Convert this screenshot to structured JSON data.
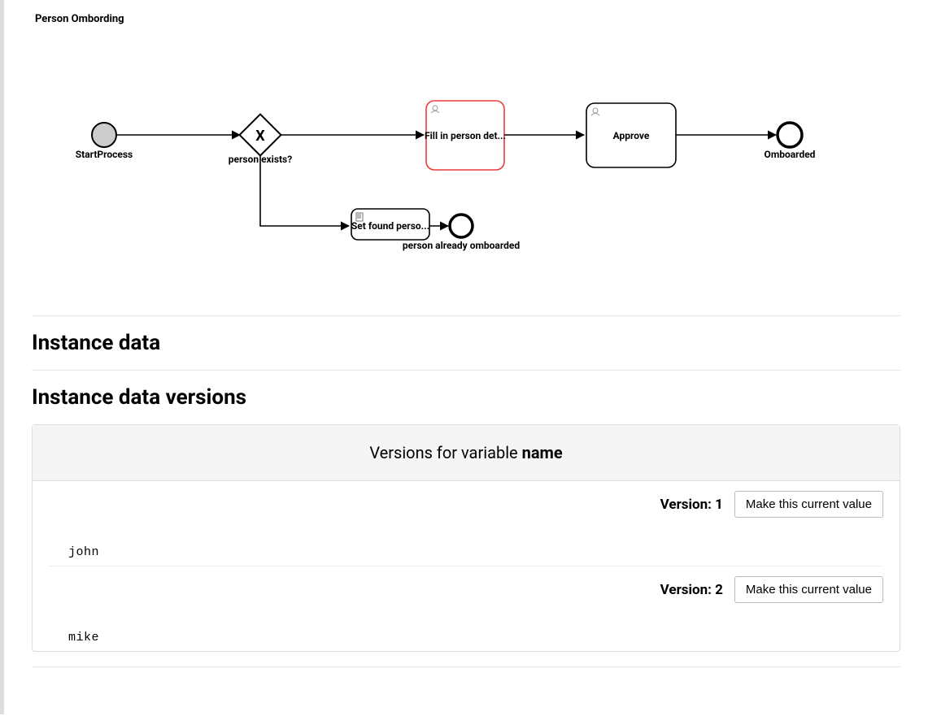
{
  "diagram": {
    "title": "Person Ombording",
    "start_label": "StartProcess",
    "gateway_label": "person exists?",
    "fill_task": "Fill in person det...",
    "approve_task": "Approve",
    "end_label": "Omboarded",
    "script_task": "Set found perso...",
    "alt_end_label": "person already omboarded"
  },
  "sections": {
    "instance_data": "Instance data",
    "instance_data_versions": "Instance data versions"
  },
  "versions_panel": {
    "header_prefix": "Versions for variable ",
    "header_var": "name",
    "button_label": "Make this current value",
    "version_label_prefix": "Version: ",
    "items": [
      {
        "version": "1",
        "value": "john"
      },
      {
        "version": "2",
        "value": "mike"
      }
    ]
  }
}
